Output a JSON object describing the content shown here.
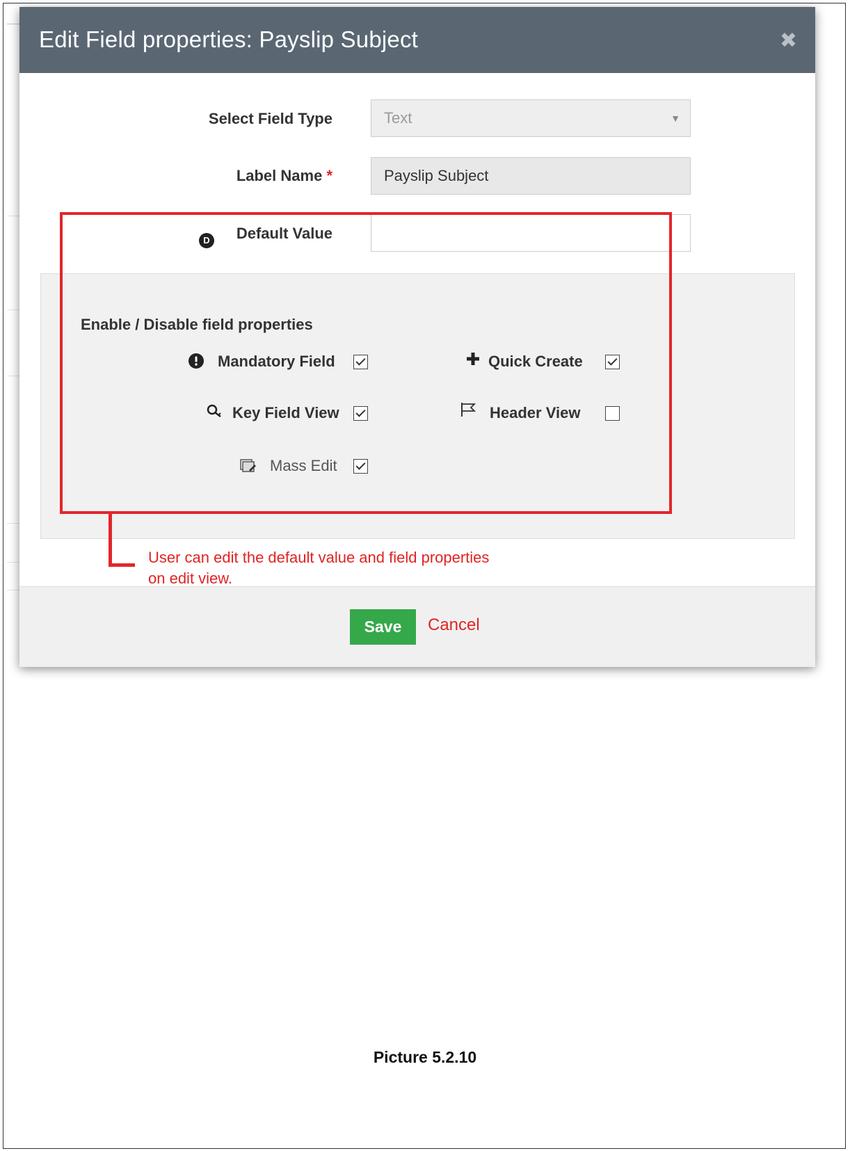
{
  "modal": {
    "title": "Edit Field properties: Payslip Subject",
    "close_glyph": "✖",
    "field_type": {
      "label": "Select Field Type",
      "value": "Text"
    },
    "label_name": {
      "label": "Label Name",
      "required_mark": "*",
      "value": "Payslip Subject"
    },
    "default_value": {
      "label": "Default Value",
      "icon_letter": "D",
      "value": ""
    },
    "properties": {
      "heading": "Enable / Disable field properties",
      "items": [
        {
          "label": "Mandatory Field",
          "icon": "exclamation-circle-icon",
          "checked": true
        },
        {
          "label": "Quick Create",
          "icon": "plus-icon",
          "checked": true
        },
        {
          "label": "Key Field View",
          "icon": "key-icon",
          "checked": true
        },
        {
          "label": "Header View",
          "icon": "flag-icon",
          "checked": false
        },
        {
          "label": "Mass Edit",
          "icon": "mass-edit-icon",
          "checked": true
        }
      ]
    },
    "annotation": {
      "line1": "User can edit the default value and field properties",
      "line2": "on edit view."
    },
    "footer": {
      "save_label": "Save",
      "cancel_label": "Cancel"
    }
  },
  "caption": "Picture 5.2.10",
  "colors": {
    "header_bg": "#5a6773",
    "save_green": "#35a84a",
    "annotation_red": "#e3262b"
  }
}
